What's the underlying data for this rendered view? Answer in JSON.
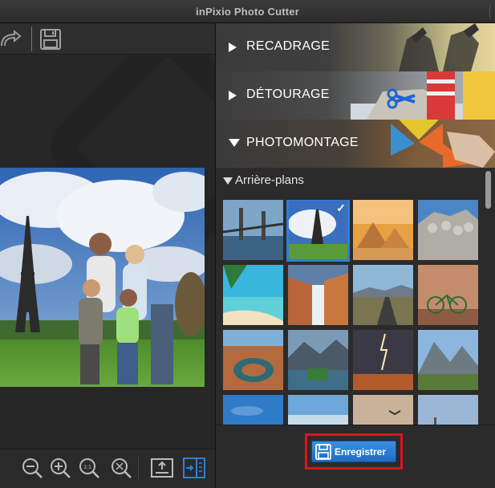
{
  "window": {
    "title": "inPixio Photo Cutter"
  },
  "toolbar": {
    "redo_icon": "redo-icon",
    "save_icon": "save-icon"
  },
  "bottom_toolbar": {
    "buttons": [
      "zoom-out-icon",
      "zoom-in-icon",
      "zoom-actual-size-icon",
      "zoom-fit-icon",
      "export-icon",
      "panel-toggle-icon"
    ],
    "zoom_actual_label": "1:1"
  },
  "sections": {
    "recadrage": "RECADRAGE",
    "detourage": "DÉTOURAGE",
    "photomontage": "PHOTOMONTAGE"
  },
  "backgrounds": {
    "header": "Arrière-plans",
    "thumbnails": [
      {
        "subject": "bridge",
        "selected": false
      },
      {
        "subject": "eiffel-tower",
        "selected": true
      },
      {
        "subject": "pyramids",
        "selected": false
      },
      {
        "subject": "mount-rushmore",
        "selected": false
      },
      {
        "subject": "tropical-beach",
        "selected": false
      },
      {
        "subject": "canyon-waterfall",
        "selected": false
      },
      {
        "subject": "desert-road",
        "selected": false
      },
      {
        "subject": "bicycle-wall",
        "selected": false
      },
      {
        "subject": "horseshoe-bend",
        "selected": false
      },
      {
        "subject": "island-stadium",
        "selected": false
      },
      {
        "subject": "lightning-storm",
        "selected": false
      },
      {
        "subject": "mountain-valley",
        "selected": false
      },
      {
        "subject": "blue-sky",
        "selected": false
      },
      {
        "subject": "ice-landscape",
        "selected": false
      },
      {
        "subject": "desert-bird",
        "selected": false
      },
      {
        "subject": "dusk-sky",
        "selected": false
      }
    ]
  },
  "footer": {
    "save_label": "Enregistrer"
  },
  "colors": {
    "accent": "#2f7fd6",
    "highlight": "#e0121a"
  }
}
